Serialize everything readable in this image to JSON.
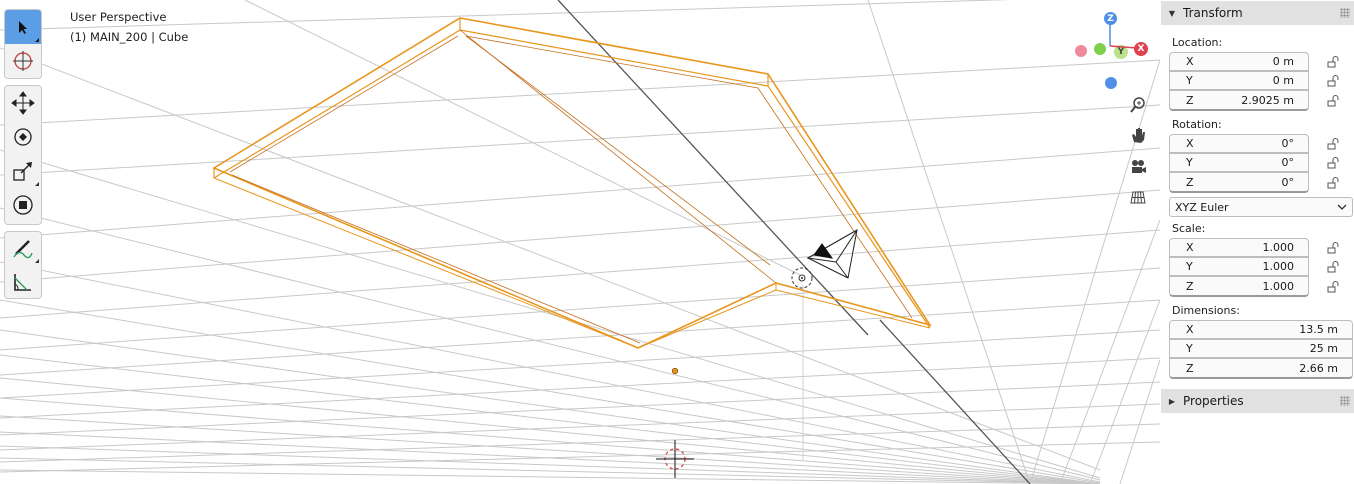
{
  "viewport": {
    "view_name": "User Perspective",
    "object_info": "(1) MAIN_200 | Cube",
    "selection_color": "#e8961e"
  },
  "toolbar": {
    "accent": "#5b9ee6",
    "tools": [
      {
        "name": "select-tool",
        "icon": "cursor-arrow-icon",
        "active": true
      },
      {
        "name": "cursor-tool",
        "icon": "3d-cursor-icon"
      },
      {
        "name": "move-tool",
        "icon": "move-arrows-icon"
      },
      {
        "name": "rotate-tool",
        "icon": "rotate-icon"
      },
      {
        "name": "scale-tool",
        "icon": "scale-icon"
      },
      {
        "name": "transform-tool",
        "icon": "transform-icon"
      },
      {
        "name": "annotate-tool",
        "icon": "pencil-icon"
      },
      {
        "name": "measure-tool",
        "icon": "ruler-icon"
      }
    ]
  },
  "gizmo": {
    "x_label": "X",
    "y_label": "Y",
    "z_label": "Z",
    "x_color": "#e0414f",
    "y_color": "#7ed04a",
    "z_color": "#4f8fe6"
  },
  "nav_buttons": [
    "zoom-icon",
    "hand-pan-icon",
    "camera-icon",
    "grid-ortho-icon"
  ],
  "panel": {
    "transform_header": "Transform",
    "location_label": "Location:",
    "location": [
      {
        "axis": "X",
        "value": "0 m"
      },
      {
        "axis": "Y",
        "value": "0 m"
      },
      {
        "axis": "Z",
        "value": "2.9025 m"
      }
    ],
    "rotation_label": "Rotation:",
    "rotation": [
      {
        "axis": "X",
        "value": "0°"
      },
      {
        "axis": "Y",
        "value": "0°"
      },
      {
        "axis": "Z",
        "value": "0°"
      }
    ],
    "rotation_mode": "XYZ Euler",
    "scale_label": "Scale:",
    "scale": [
      {
        "axis": "X",
        "value": "1.000"
      },
      {
        "axis": "Y",
        "value": "1.000"
      },
      {
        "axis": "Z",
        "value": "1.000"
      }
    ],
    "dimensions_label": "Dimensions:",
    "dimensions": [
      {
        "axis": "X",
        "value": "13.5 m"
      },
      {
        "axis": "Y",
        "value": "25 m"
      },
      {
        "axis": "Z",
        "value": "2.66 m"
      }
    ],
    "properties_header": "Properties"
  }
}
